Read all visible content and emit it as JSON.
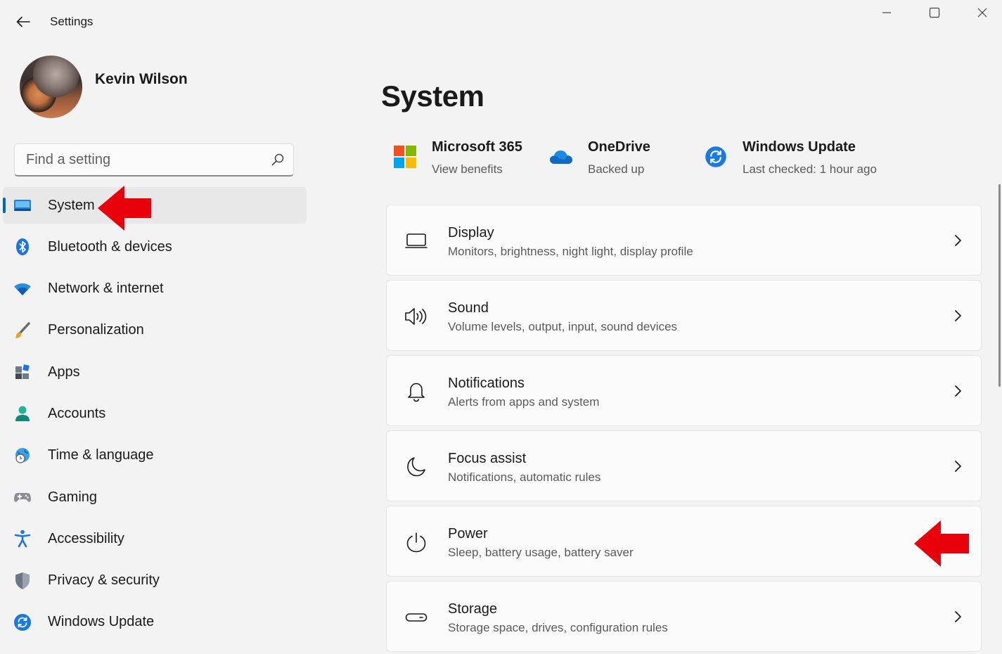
{
  "window": {
    "title": "Settings"
  },
  "profile": {
    "name": "Kevin Wilson"
  },
  "search": {
    "placeholder": "Find a setting"
  },
  "sidebar": {
    "items": [
      {
        "label": "System",
        "icon": "system-icon",
        "active": true
      },
      {
        "label": "Bluetooth & devices",
        "icon": "bluetooth-icon"
      },
      {
        "label": "Network & internet",
        "icon": "wifi-icon"
      },
      {
        "label": "Personalization",
        "icon": "brush-icon"
      },
      {
        "label": "Apps",
        "icon": "apps-icon"
      },
      {
        "label": "Accounts",
        "icon": "person-icon"
      },
      {
        "label": "Time & language",
        "icon": "globe-clock-icon"
      },
      {
        "label": "Gaming",
        "icon": "gamepad-icon"
      },
      {
        "label": "Accessibility",
        "icon": "accessibility-icon"
      },
      {
        "label": "Privacy & security",
        "icon": "shield-icon"
      },
      {
        "label": "Windows Update",
        "icon": "update-icon"
      }
    ]
  },
  "main": {
    "title": "System",
    "top_cards": [
      {
        "title": "Microsoft 365",
        "subtitle": "View benefits",
        "icon": "microsoft-logo-icon"
      },
      {
        "title": "OneDrive",
        "subtitle": "Backed up",
        "icon": "cloud-icon"
      },
      {
        "title": "Windows Update",
        "subtitle": "Last checked: 1 hour ago",
        "icon": "update-icon"
      }
    ],
    "cards": [
      {
        "title": "Display",
        "subtitle": "Monitors, brightness, night light, display profile",
        "icon": "monitor-icon"
      },
      {
        "title": "Sound",
        "subtitle": "Volume levels, output, input, sound devices",
        "icon": "speaker-icon"
      },
      {
        "title": "Notifications",
        "subtitle": "Alerts from apps and system",
        "icon": "bell-icon"
      },
      {
        "title": "Focus assist",
        "subtitle": "Notifications, automatic rules",
        "icon": "moon-icon"
      },
      {
        "title": "Power",
        "subtitle": "Sleep, battery usage, battery saver",
        "icon": "power-icon"
      },
      {
        "title": "Storage",
        "subtitle": "Storage space, drives, configuration rules",
        "icon": "drive-icon"
      }
    ]
  },
  "colors": {
    "accent": "#0067c0",
    "annotation": "#e8000b",
    "background": "#f3f3f3"
  }
}
